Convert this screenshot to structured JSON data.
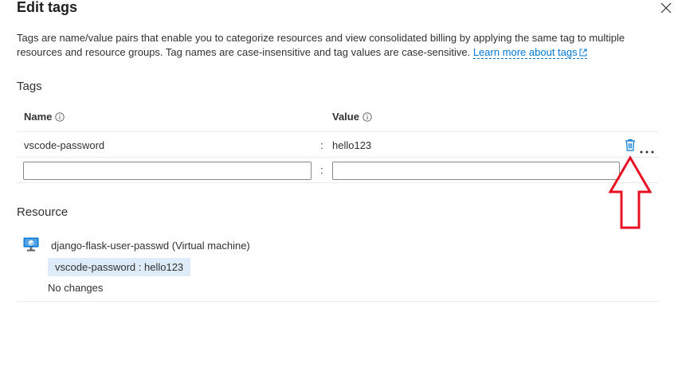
{
  "dialog": {
    "title": "Edit tags",
    "description": "Tags are name/value pairs that enable you to categorize resources and view consolidated billing by applying the same tag to multiple resources and resource groups. Tag names are case-insensitive and tag values are case-sensitive.",
    "learn_more_link": "Learn more about tags"
  },
  "tags_section": {
    "heading": "Tags",
    "columns": {
      "name": "Name",
      "value": "Value"
    },
    "rows": [
      {
        "name": "vscode-password",
        "separator": ":",
        "value": "hello123"
      }
    ],
    "new_row": {
      "separator": ":",
      "name_value": "",
      "value_value": ""
    }
  },
  "resource_section": {
    "heading": "Resource",
    "resource_name": "django-flask-user-passwd (Virtual machine)",
    "tag_chip": "vscode-password : hello123",
    "status": "No changes"
  },
  "icons": {
    "close": "close-icon",
    "info": "info-icon",
    "delete": "trash-icon",
    "more": "more-icon",
    "external": "external-link-icon",
    "vm": "virtual-machine-icon",
    "annotation": "red-arrow-annotation"
  },
  "colors": {
    "link": "#0078d4",
    "chip_bg": "#deecf9",
    "annotation": "#e81123"
  }
}
